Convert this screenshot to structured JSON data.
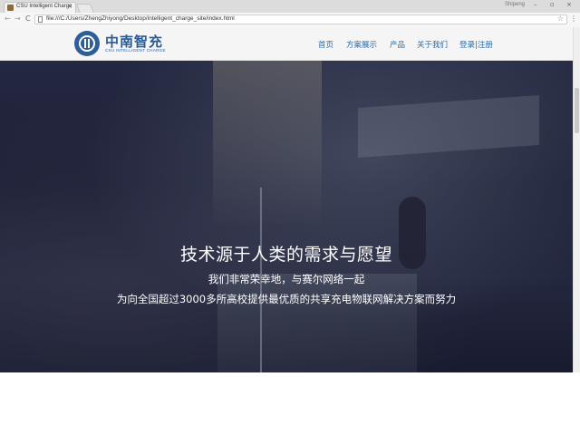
{
  "browser": {
    "tab_title": "CSU Intelligent Charge",
    "tab_close": "×",
    "profile_name": "Shipeng",
    "window_controls": [
      "–",
      "▫",
      "×"
    ],
    "url": "file:///C:/Users/ZhengZhiyong/Desktop/intelligent_charge_site/index.html",
    "back": "←",
    "forward": "→",
    "reload": "C",
    "star": "☆",
    "menu": "⋮"
  },
  "site": {
    "brand_name": "中南智充",
    "brand_subtitle": "CSU INTELLIGENT CHARGE",
    "nav": [
      "首页",
      "方案展示",
      "产品",
      "关于我们",
      "登录|注册"
    ]
  },
  "hero": {
    "headline": "技术源于人类的需求与愿望",
    "line2": "我们非常荣幸地，与赛尔网络一起",
    "line3": "为向全国超过3000多所高校提供最优质的共享充电物联网解决方案而努力"
  }
}
